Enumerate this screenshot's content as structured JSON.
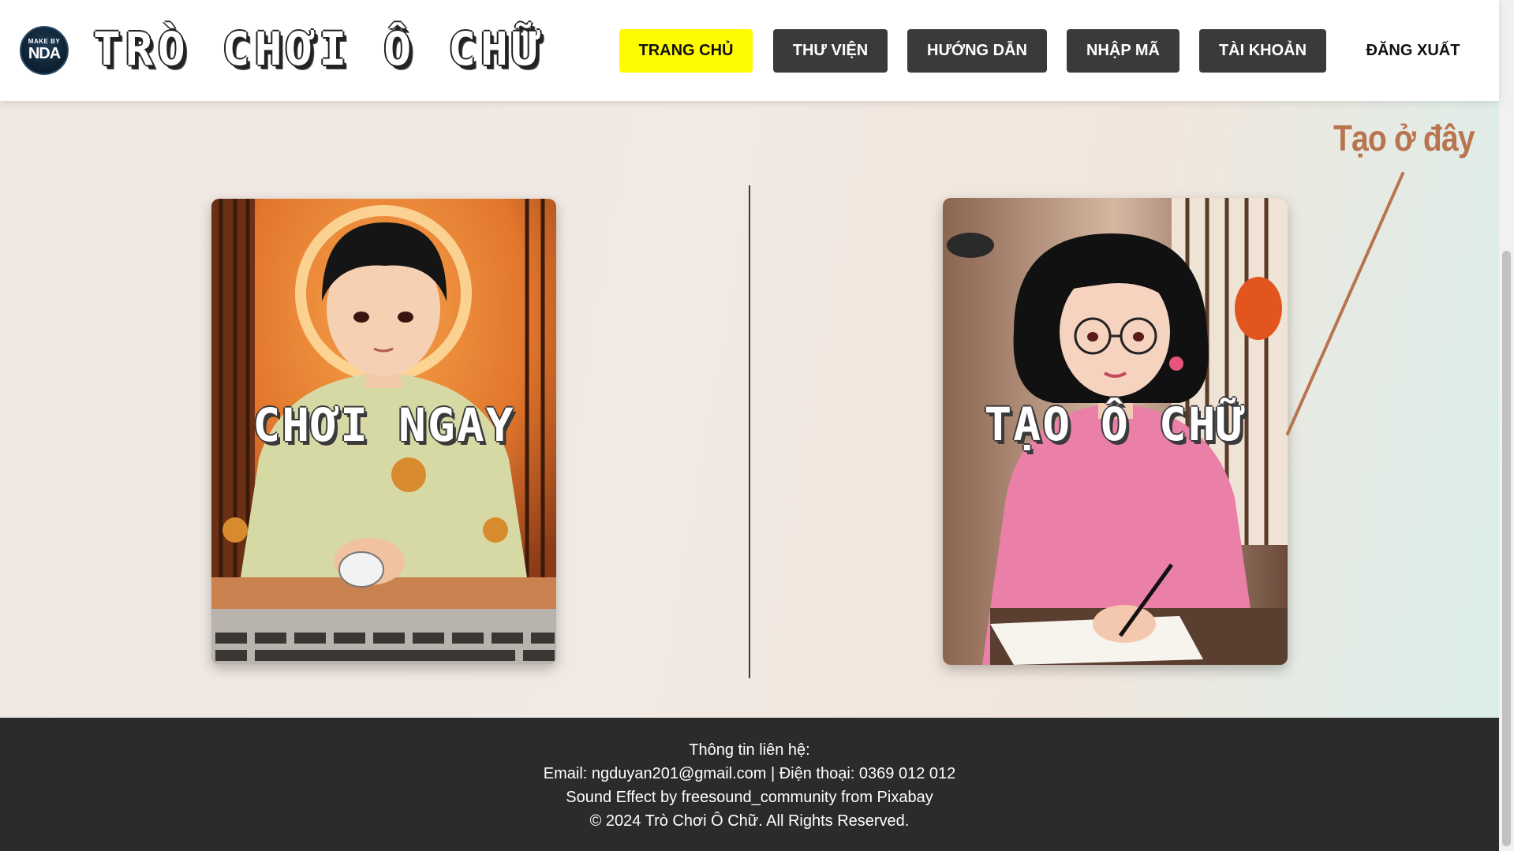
{
  "header": {
    "logo": {
      "small_text": "MAKE BY",
      "main_text": "NDA"
    },
    "site_title": "TRÒ CHƠI Ô CHỮ",
    "nav": [
      {
        "label": "TRANG CHỦ",
        "active": true
      },
      {
        "label": "THƯ VIỆN",
        "active": false
      },
      {
        "label": "HƯỚNG DẪN",
        "active": false
      },
      {
        "label": "NHẬP MÃ",
        "active": false
      },
      {
        "label": "TÀI KHOẢN",
        "active": false
      },
      {
        "label": "ĐĂNG XUẤT",
        "active": false
      }
    ]
  },
  "main": {
    "play_card": {
      "label": "CHƠI NGAY",
      "icon": "player-at-computer-illustration"
    },
    "create_card": {
      "label": "TẠO Ô CHỮ",
      "icon": "girl-writing-illustration"
    },
    "hint": {
      "text": "Tạo ở đây",
      "color": "#b8744e"
    }
  },
  "footer": {
    "heading": "Thông tin liên hệ:",
    "contact": "Email: ngduyan201@gmail.com | Điện thoại: 0369 012 012",
    "credit": "Sound Effect by freesound_community from Pixabay",
    "copyright": "© 2024 Trò Chơi Ô Chữ. All Rights Reserved."
  },
  "colors": {
    "active_nav": "#fffb00",
    "nav": "#3a3a3a",
    "footer": "#2b2b2b"
  }
}
